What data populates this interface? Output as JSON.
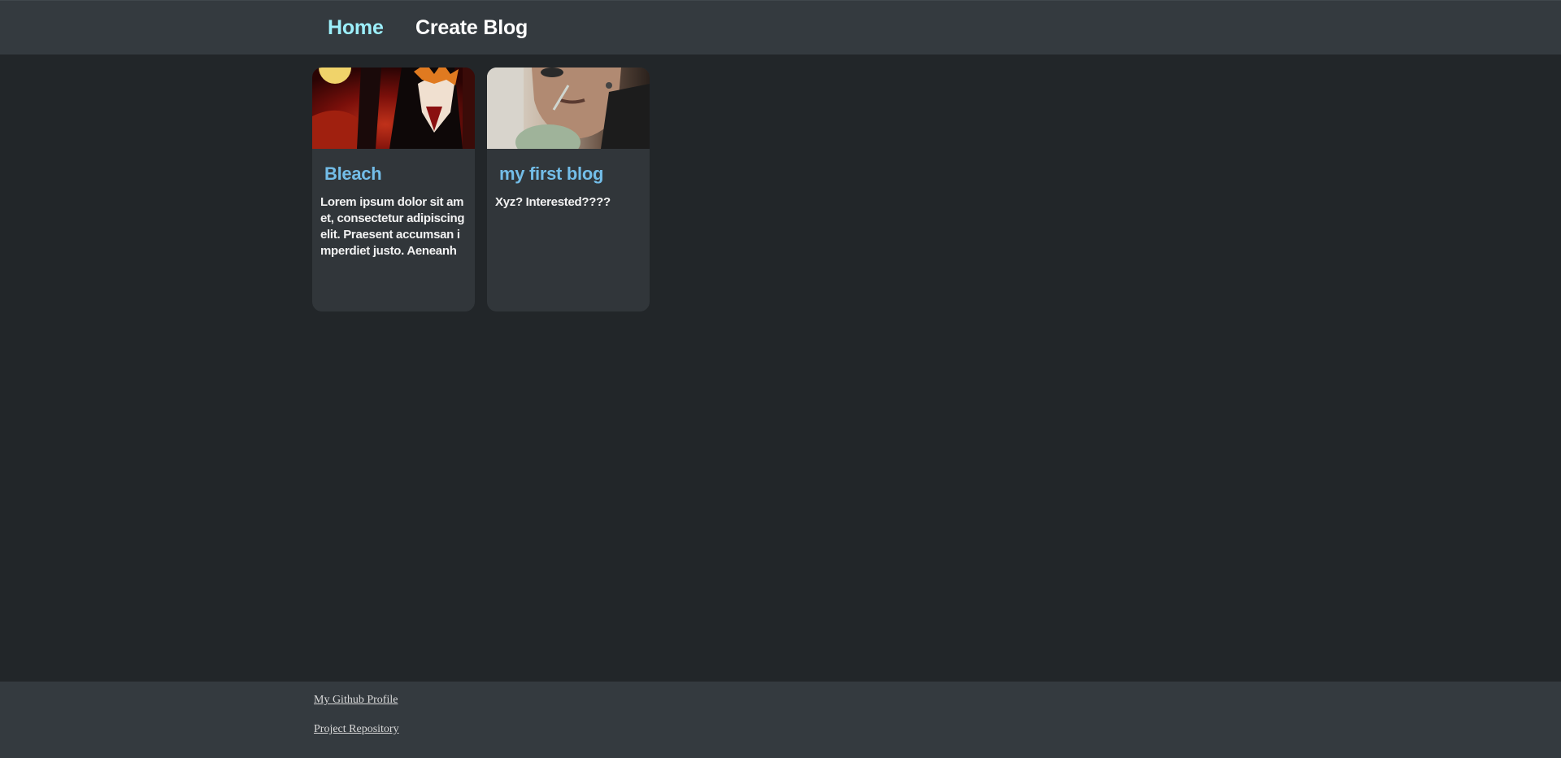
{
  "nav": {
    "home_label": "Home",
    "create_label": "Create Blog",
    "home_color": "#9ceffb",
    "create_color": "#ffffff"
  },
  "blogs": [
    {
      "title": "Bleach",
      "excerpt": "Lorem ipsum dolor sit amet, consectetur adipiscing elit. Praesent accumsan imperdiet justo. Aeneanh",
      "thumbnail": "anime-character-image"
    },
    {
      "title": "my first blog",
      "excerpt": "Xyz? Interested????",
      "thumbnail": "person-drinking-photo"
    }
  ],
  "footer": {
    "github_label": "My Github Profile",
    "repo_label": "Project Repository"
  },
  "colors": {
    "page_bg": "#222629",
    "bar_bg": "#343a3f",
    "card_bg": "#31363a",
    "title_accent": "#73bde8"
  }
}
